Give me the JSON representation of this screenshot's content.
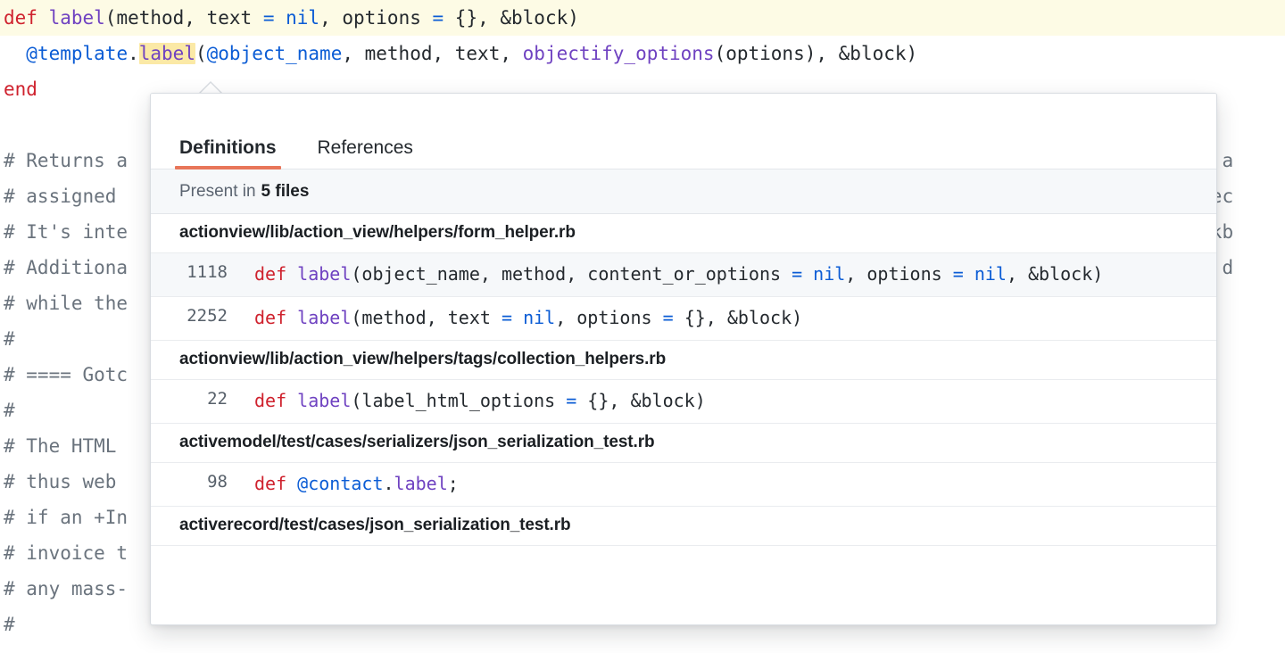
{
  "editor": {
    "lines": [
      {
        "highlighted": true,
        "tokens": [
          {
            "t": "def ",
            "c": "kw"
          },
          {
            "t": "label",
            "c": "fn"
          },
          {
            "t": "(method, text ",
            "c": "plain"
          },
          {
            "t": "=",
            "c": "op"
          },
          {
            "t": " ",
            "c": "plain"
          },
          {
            "t": "nil",
            "c": "op"
          },
          {
            "t": ", options ",
            "c": "plain"
          },
          {
            "t": "=",
            "c": "op"
          },
          {
            "t": " {}, &block)",
            "c": "plain"
          }
        ]
      },
      {
        "highlighted": false,
        "tokens": [
          {
            "t": "  ",
            "c": "plain"
          },
          {
            "t": "@template",
            "c": "var"
          },
          {
            "t": ".",
            "c": "plain"
          },
          {
            "t": "label",
            "c": "mark"
          },
          {
            "t": "(",
            "c": "plain"
          },
          {
            "t": "@object_name",
            "c": "var"
          },
          {
            "t": ", method, text, ",
            "c": "plain"
          },
          {
            "t": "objectify_options",
            "c": "fn"
          },
          {
            "t": "(options), &block)",
            "c": "plain"
          }
        ]
      },
      {
        "highlighted": false,
        "tokens": [
          {
            "t": "end",
            "c": "kw"
          }
        ]
      },
      {
        "highlighted": false,
        "tokens": [
          {
            "t": "",
            "c": "plain"
          }
        ]
      },
      {
        "highlighted": false,
        "tokens": [
          {
            "t": "# Returns a                                                                                              on a",
            "c": "comment"
          }
        ]
      },
      {
        "highlighted": false,
        "tokens": [
          {
            "t": "# assigned                                                                                             +objec",
            "c": "comment"
          }
        ]
      },
      {
        "highlighted": false,
        "tokens": [
          {
            "t": "# It's inte                                                                                            checkb",
            "c": "comment"
          }
        ]
      },
      {
        "highlighted": false,
        "tokens": [
          {
            "t": "# Additiona                                                                                            lue+ d",
            "c": "comment"
          }
        ]
      },
      {
        "highlighted": false,
        "tokens": [
          {
            "t": "# while the",
            "c": "comment"
          }
        ]
      },
      {
        "highlighted": false,
        "tokens": [
          {
            "t": "#",
            "c": "comment"
          }
        ]
      },
      {
        "highlighted": false,
        "tokens": [
          {
            "t": "# ==== Gotc",
            "c": "comment"
          }
        ]
      },
      {
        "highlighted": false,
        "tokens": [
          {
            "t": "#",
            "c": "comment"
          }
        ]
      },
      {
        "highlighted": false,
        "tokens": [
          {
            "t": "# The HTML",
            "c": "comment"
          }
        ]
      },
      {
        "highlighted": false,
        "tokens": [
          {
            "t": "# thus web",
            "c": "comment"
          }
        ]
      },
      {
        "highlighted": false,
        "tokens": [
          {
            "t": "# if an +In",
            "c": "comment"
          }
        ]
      },
      {
        "highlighted": false,
        "tokens": [
          {
            "t": "# invoice t",
            "c": "comment"
          }
        ]
      },
      {
        "highlighted": false,
        "tokens": [
          {
            "t": "# any mass-",
            "c": "comment"
          }
        ]
      },
      {
        "highlighted": false,
        "tokens": [
          {
            "t": "#",
            "c": "comment"
          }
        ]
      }
    ]
  },
  "popover": {
    "tabs": [
      {
        "label": "Definitions",
        "active": true
      },
      {
        "label": "References",
        "active": false
      }
    ],
    "present_in": {
      "prefix": "Present in",
      "count_label": "5 files"
    },
    "groups": [
      {
        "file": "actionview/lib/action_view/helpers/form_helper.rb",
        "hits": [
          {
            "line": "1118",
            "shaded": true,
            "tokens": [
              {
                "t": "def ",
                "c": "kw"
              },
              {
                "t": "label",
                "c": "fn"
              },
              {
                "t": "(object_name, method, content_or_options ",
                "c": "plain"
              },
              {
                "t": "=",
                "c": "op"
              },
              {
                "t": " ",
                "c": "plain"
              },
              {
                "t": "nil",
                "c": "op"
              },
              {
                "t": ", options ",
                "c": "plain"
              },
              {
                "t": "=",
                "c": "op"
              },
              {
                "t": " ",
                "c": "plain"
              },
              {
                "t": "nil",
                "c": "op"
              },
              {
                "t": ", &block)",
                "c": "plain"
              }
            ]
          },
          {
            "line": "2252",
            "shaded": false,
            "tokens": [
              {
                "t": "def ",
                "c": "kw"
              },
              {
                "t": "label",
                "c": "fn"
              },
              {
                "t": "(method, text ",
                "c": "plain"
              },
              {
                "t": "=",
                "c": "op"
              },
              {
                "t": " ",
                "c": "plain"
              },
              {
                "t": "nil",
                "c": "op"
              },
              {
                "t": ", options ",
                "c": "plain"
              },
              {
                "t": "=",
                "c": "op"
              },
              {
                "t": " {}, &block)",
                "c": "plain"
              }
            ]
          }
        ]
      },
      {
        "file": "actionview/lib/action_view/helpers/tags/collection_helpers.rb",
        "hits": [
          {
            "line": "22",
            "shaded": false,
            "tokens": [
              {
                "t": "def ",
                "c": "kw"
              },
              {
                "t": "label",
                "c": "fn"
              },
              {
                "t": "(label_html_options ",
                "c": "plain"
              },
              {
                "t": "=",
                "c": "op"
              },
              {
                "t": " {}, &block)",
                "c": "plain"
              }
            ]
          }
        ]
      },
      {
        "file": "activemodel/test/cases/serializers/json_serialization_test.rb",
        "hits": [
          {
            "line": "98",
            "shaded": false,
            "tokens": [
              {
                "t": "def ",
                "c": "kw"
              },
              {
                "t": "@contact",
                "c": "var"
              },
              {
                "t": ".",
                "c": "plain"
              },
              {
                "t": "label",
                "c": "fn"
              },
              {
                "t": ";",
                "c": "plain"
              }
            ]
          }
        ]
      },
      {
        "file": "activerecord/test/cases/json_serialization_test.rb",
        "hits": []
      }
    ]
  },
  "colors": {
    "accent_underline": "#e8765a",
    "keyword": "#cf222e",
    "function": "#6f42c1",
    "variable": "#0b5cd5",
    "comment": "#6a737d",
    "highlight_line": "#fdfbe5",
    "highlight_token": "#fbe9a6",
    "row_shaded": "#f6f8fa"
  }
}
